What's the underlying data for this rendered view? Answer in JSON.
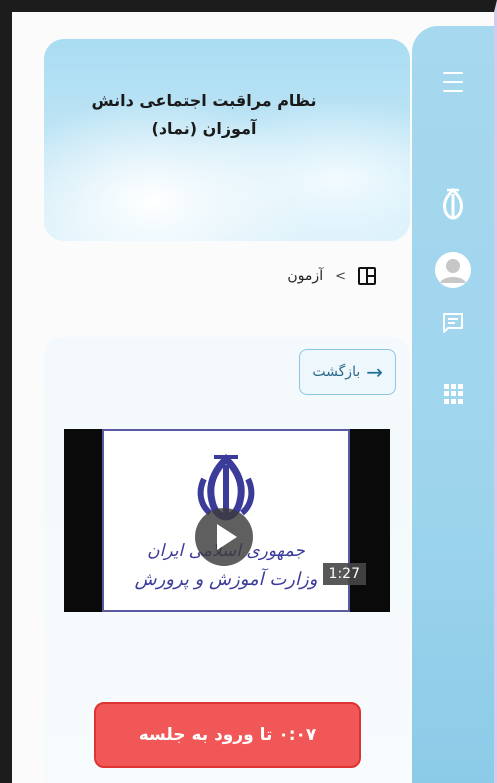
{
  "header": {
    "title": "نظام مراقبت اجتماعی دانش آموزان (نماد)"
  },
  "breadcrumb": {
    "separator": ">",
    "current": "آزمون"
  },
  "back_button": {
    "label": "بازگشت"
  },
  "video": {
    "poster_line1": "جمهوری اسلامی ایران",
    "poster_line2": "وزارت آموزش و پرورش",
    "duration": "1:27"
  },
  "enter_button": {
    "label": "۰:۰۷ تا ورود به جلسه"
  },
  "colors": {
    "sidebar": "#9ed5ed",
    "enter_button": "#f25757",
    "back_button_border": "#8cc6e2"
  },
  "icons": {
    "sidebar": [
      "menu-icon",
      "emblem-icon",
      "avatar-icon",
      "chat-icon",
      "grid-icon"
    ]
  }
}
